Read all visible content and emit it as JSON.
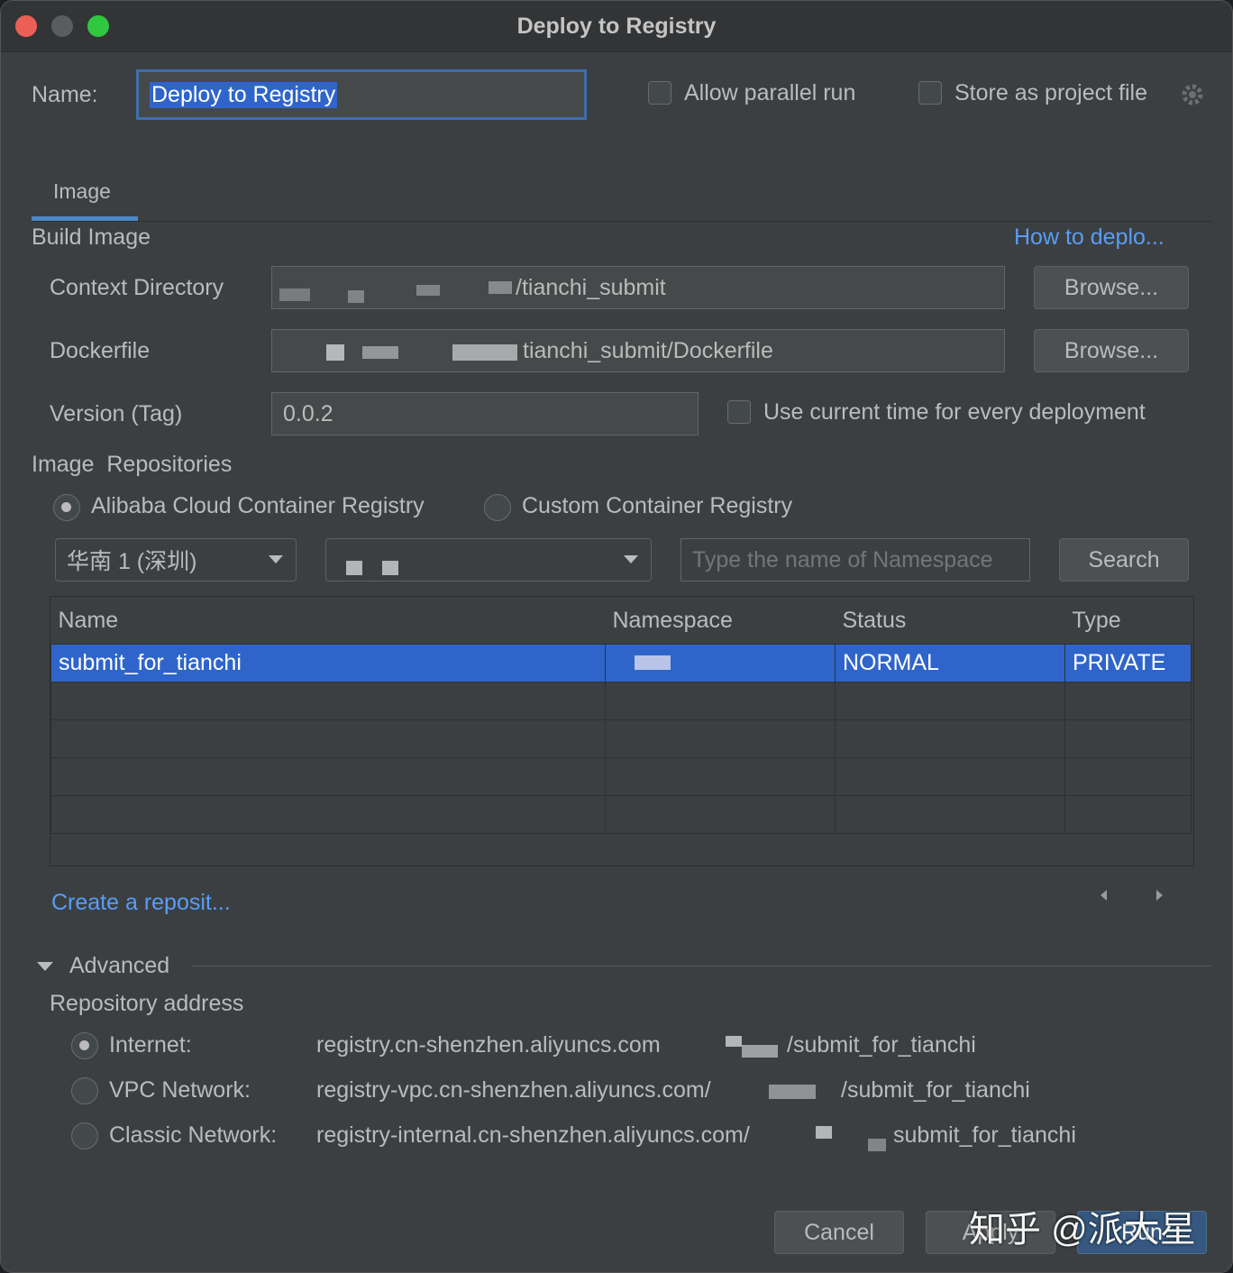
{
  "window": {
    "title": "Deploy to Registry"
  },
  "header": {
    "name_label": "Name:",
    "name_value": "Deploy to Registry",
    "allow_parallel": "Allow parallel run",
    "store_project": "Store as project file"
  },
  "tabs": [
    {
      "label": "Image"
    }
  ],
  "build": {
    "section": "Build Image",
    "how_link": "How to deplo...",
    "context_label": "Context Directory",
    "context_value": "/tianchi_submit",
    "dockerfile_label": "Dockerfile",
    "dockerfile_value": "tianchi_submit/Dockerfile",
    "browse": "Browse...",
    "version_label": "Version (Tag)",
    "version_value": "0.0.2",
    "use_time": "Use current time for every deployment"
  },
  "repos": {
    "section": "Image  Repositories",
    "alibaba": "Alibaba Cloud Container Registry",
    "custom": "Custom Container Registry",
    "region": "华南 1 (深圳)",
    "namespace_placeholder": "Type the name of Namespace",
    "search": "Search",
    "columns": [
      "Name",
      "Namespace",
      "Status",
      "Type"
    ],
    "rows": [
      {
        "name": "submit_for_tianchi",
        "namespace": "",
        "status": "NORMAL",
        "type": "PRIVATE"
      }
    ],
    "create_link": "Create a reposit..."
  },
  "advanced": {
    "label": "Advanced",
    "repo_address": "Repository address",
    "internet_label": "Internet:",
    "internet_value": "registry.cn-shenzhen.aliyuncs.com",
    "internet_suffix": "/submit_for_tianchi",
    "vpc_label": "VPC Network:",
    "vpc_value": "registry-vpc.cn-shenzhen.aliyuncs.com/",
    "vpc_suffix": "/submit_for_tianchi",
    "classic_label": "Classic Network:",
    "classic_value": "registry-internal.cn-shenzhen.aliyuncs.com/",
    "classic_suffix": "submit_for_tianchi"
  },
  "footer": {
    "cancel": "Cancel",
    "apply": "Apply",
    "run": "Run"
  },
  "watermark": "知乎 @派大星",
  "colors": {
    "accent": "#589df6",
    "selection": "#2f65ca",
    "background": "#3c3f41"
  }
}
